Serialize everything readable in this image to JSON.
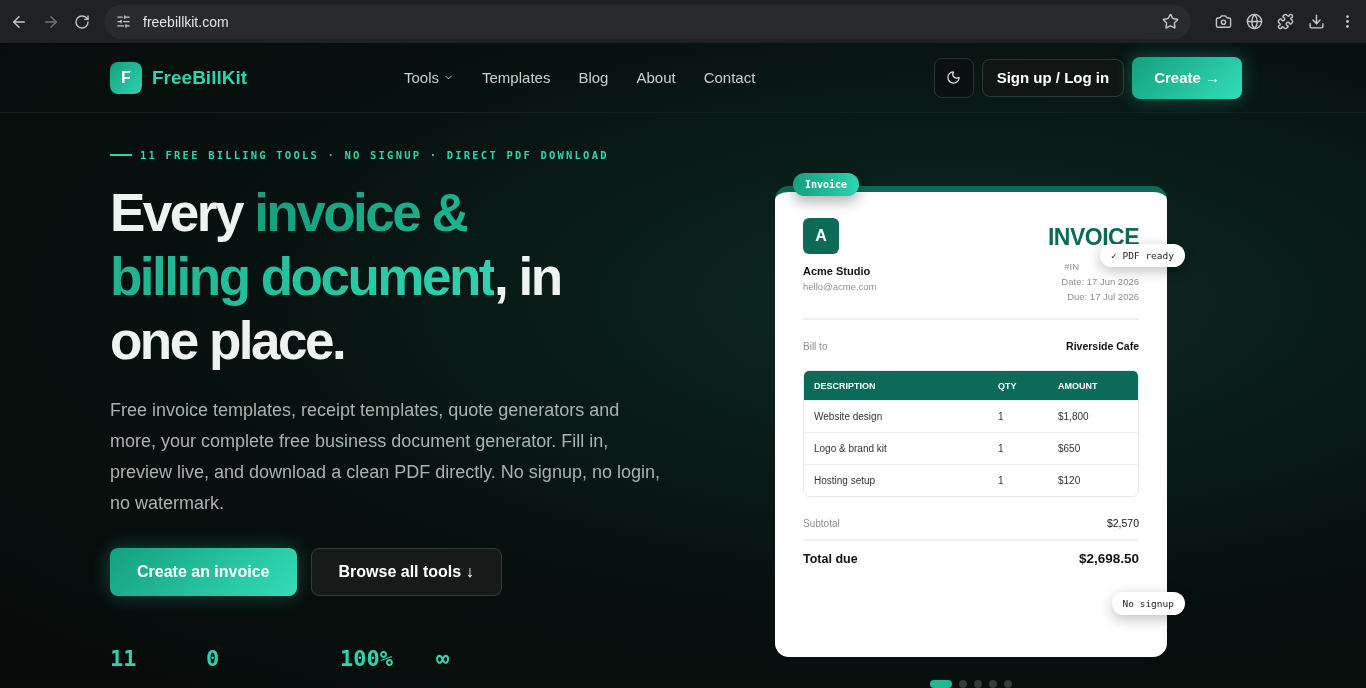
{
  "browser": {
    "url": "freebillkit.com"
  },
  "nav": {
    "brand_mark": "F",
    "brand": "FreeBillKit",
    "links": [
      {
        "label": "Tools",
        "dropdown": true
      },
      {
        "label": "Templates",
        "dropdown": false
      },
      {
        "label": "Blog",
        "dropdown": false
      },
      {
        "label": "About",
        "dropdown": false
      },
      {
        "label": "Contact",
        "dropdown": false
      }
    ],
    "login": "Sign up / Log in",
    "create": "Create →"
  },
  "hero": {
    "kicker": "11 FREE BILLING TOOLS · NO SIGNUP · DIRECT PDF DOWNLOAD",
    "headline": [
      {
        "text": "Every ",
        "accent": false
      },
      {
        "text": "invoice & billing document",
        "accent": true
      },
      {
        "text": ", in one place.",
        "accent": false
      }
    ],
    "description": "Free invoice templates, receipt templates, quote generators and more, your complete free business document generator. Fill in, preview live, and download a clean PDF directly. No signup, no login, no watermark.",
    "primary": "Create an invoice",
    "secondary": "Browse all tools ↓",
    "stats": [
      "11",
      "0",
      "100%",
      "∞"
    ]
  },
  "invoice": {
    "tag": "Invoice",
    "logo": "A",
    "title": "INVOICE",
    "company": "Acme Studio",
    "email": "hello@acme.com",
    "number": "#IN",
    "date": "Date: 17 Jun 2026",
    "due": "Due: 17 Jul 2026",
    "bill_to_label": "Bill to",
    "bill_to": "Riverside Cafe",
    "columns": [
      "DESCRIPTION",
      "QTY",
      "AMOUNT"
    ],
    "rows": [
      [
        "Website design",
        "1",
        "$1,800"
      ],
      [
        "Logo & brand kit",
        "1",
        "$650"
      ],
      [
        "Hosting setup",
        "1",
        "$120"
      ]
    ],
    "subtotal_label": "Subtotal",
    "subtotal": "$2,570",
    "total_label": "Total due",
    "total": "$2,698.50",
    "badges": [
      {
        "text": "✓ PDF ready",
        "kind": "ready"
      },
      {
        "text": "No signup",
        "kind": "signup"
      }
    ]
  },
  "carousel": [
    {
      "selected": true
    },
    {
      "selected": false
    },
    {
      "selected": false
    },
    {
      "selected": false
    },
    {
      "selected": false
    }
  ]
}
